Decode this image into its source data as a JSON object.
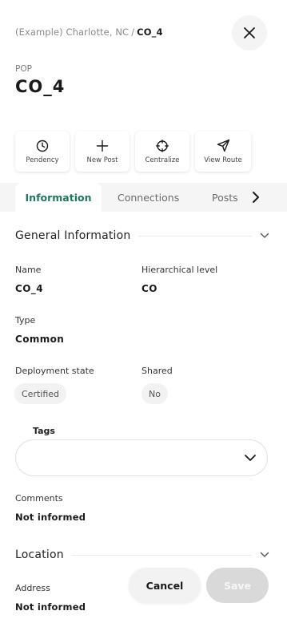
{
  "breadcrumb": {
    "parent": "(Example) Charlotte, NC",
    "separator": "/",
    "current": "CO_4"
  },
  "header": {
    "type_label": "POP",
    "title": "CO_4"
  },
  "actions": [
    {
      "label": "Pendency",
      "icon": "clock-icon"
    },
    {
      "label": "New Post",
      "icon": "plus-icon"
    },
    {
      "label": "Centralize",
      "icon": "crosshair-icon"
    },
    {
      "label": "View Route",
      "icon": "send-icon"
    }
  ],
  "tabs": [
    {
      "label": "Information",
      "active": true
    },
    {
      "label": "Connections"
    },
    {
      "label": "Posts"
    }
  ],
  "general": {
    "title": "General Information",
    "name_label": "Name",
    "name_value": "CO_4",
    "level_label": "Hierarchical level",
    "level_value": "CO",
    "type_label": "Type",
    "type_value": "Common",
    "deploy_label": "Deployment state",
    "deploy_value": "Certified",
    "shared_label": "Shared",
    "shared_value": "No",
    "tags_label": "Tags",
    "tags_value": "",
    "comments_label": "Comments",
    "comments_value": "Not informed"
  },
  "location": {
    "title": "Location",
    "address_label": "Address",
    "address_value": "Not informed"
  },
  "footer": {
    "cancel_label": "Cancel",
    "save_label": "Save"
  },
  "colors": {
    "accent": "#1e7a59",
    "tabs_background": "#f5f5f5",
    "chip_background": "#f2f2f2",
    "save_disabled": "#d9d9d9"
  }
}
